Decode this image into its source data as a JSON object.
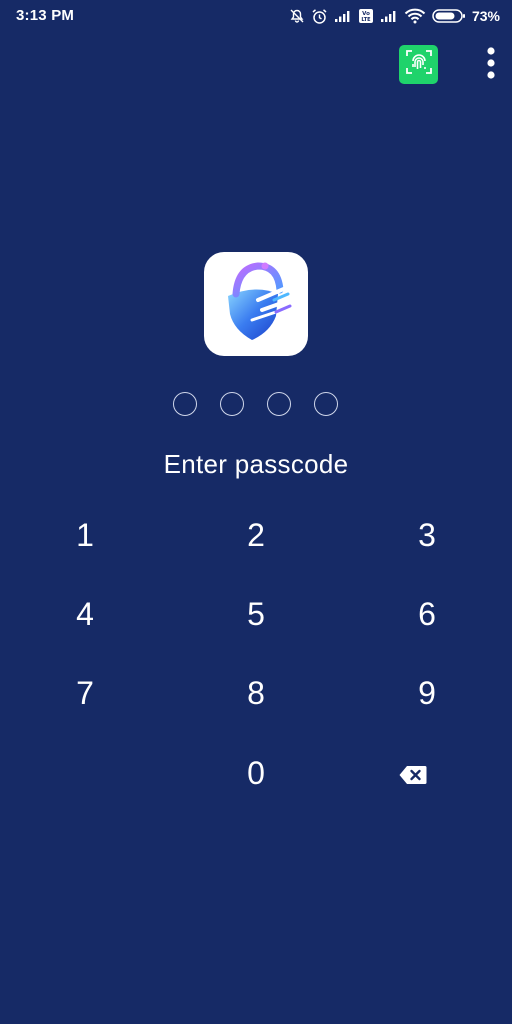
{
  "status_bar": {
    "time": "3:13 PM",
    "battery_percent": "73%",
    "icons": [
      "mute-icon",
      "alarm-icon",
      "signal-icon",
      "volte-icon",
      "signal-icon",
      "wifi-icon",
      "battery-icon"
    ],
    "volte_label": "Vo LTE"
  },
  "header": {
    "fingerprint_icon": "fingerprint-icon",
    "fingerprint_color": "#1fd36b",
    "menu_icon": "more-vertical-icon"
  },
  "logo": {
    "icon": "shield-lock-icon",
    "colors": [
      "#b86bff",
      "#4aa8ff",
      "#1e5ae0"
    ]
  },
  "passcode": {
    "length": 4,
    "entered": 0,
    "prompt": "Enter passcode"
  },
  "keypad": {
    "rows": [
      [
        "1",
        "2",
        "3"
      ],
      [
        "4",
        "5",
        "6"
      ],
      [
        "7",
        "8",
        "9"
      ],
      [
        "",
        "0",
        "backspace"
      ]
    ],
    "backspace_icon": "backspace-icon"
  },
  "theme": {
    "background": "#162a66",
    "text": "#ffffff"
  }
}
